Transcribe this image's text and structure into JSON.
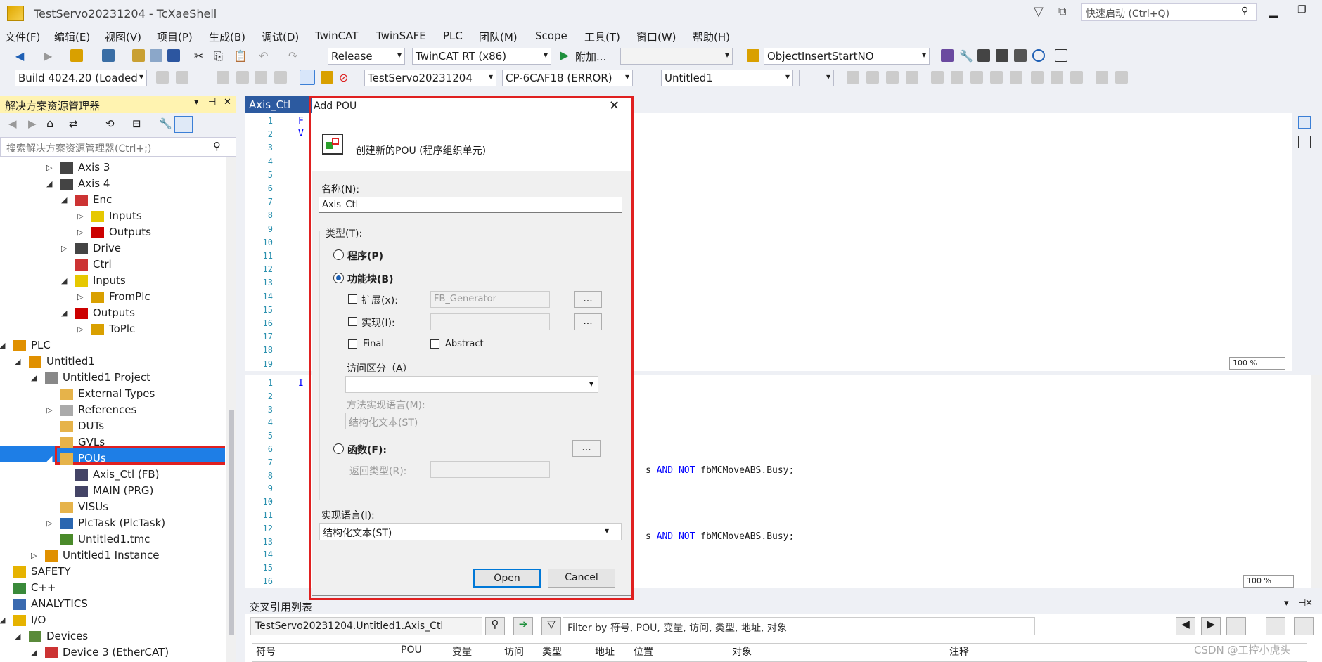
{
  "window": {
    "title": "TestServo20231204 - TcXaeShell",
    "quick_launch": "快速启动 (Ctrl+Q)"
  },
  "menu": [
    "文件(F)",
    "编辑(E)",
    "视图(V)",
    "项目(P)",
    "生成(B)",
    "调试(D)",
    "TwinCAT",
    "TwinSAFE",
    "PLC",
    "团队(M)",
    "Scope",
    "工具(T)",
    "窗口(W)",
    "帮助(H)"
  ],
  "toolbar1": {
    "config": "Release",
    "platform": "TwinCAT RT (x86)",
    "attach": "附加...",
    "object": "ObjectInsertStartNO"
  },
  "toolbar2": {
    "build": "Build 4024.20 (Loaded",
    "solution": "TestServo20231204",
    "target": "CP-6CAF18 (ERROR)",
    "project": "Untitled1"
  },
  "solution_explorer": {
    "title": "解决方案资源管理器",
    "search_placeholder": "搜索解决方案资源管理器(Ctrl+;)",
    "items": [
      {
        "label": "Axis 3"
      },
      {
        "label": "Axis 4"
      },
      {
        "label": "Enc"
      },
      {
        "label": "Inputs"
      },
      {
        "label": "Outputs"
      },
      {
        "label": "Drive"
      },
      {
        "label": "Ctrl"
      },
      {
        "label": "Inputs"
      },
      {
        "label": "FromPlc"
      },
      {
        "label": "Outputs"
      },
      {
        "label": "ToPlc"
      },
      {
        "label": "PLC"
      },
      {
        "label": "Untitled1"
      },
      {
        "label": "Untitled1 Project"
      },
      {
        "label": "External Types"
      },
      {
        "label": "References"
      },
      {
        "label": "DUTs"
      },
      {
        "label": "GVLs"
      },
      {
        "label": "POUs"
      },
      {
        "label": "Axis_Ctl (FB)"
      },
      {
        "label": "MAIN (PRG)"
      },
      {
        "label": "VISUs"
      },
      {
        "label": "PlcTask (PlcTask)"
      },
      {
        "label": "Untitled1.tmc"
      },
      {
        "label": "Untitled1 Instance"
      },
      {
        "label": "SAFETY"
      },
      {
        "label": "C++"
      },
      {
        "label": "ANALYTICS"
      },
      {
        "label": "I/O"
      },
      {
        "label": "Devices"
      },
      {
        "label": "Device 3 (EtherCAT)"
      }
    ]
  },
  "editor": {
    "tab": "Axis_Ctl",
    "top_lines": [
      "1",
      "2",
      "3",
      "4",
      "5",
      "6",
      "7",
      "8",
      "9",
      "10",
      "11",
      "12",
      "13",
      "14",
      "15",
      "16",
      "17",
      "18",
      "19"
    ],
    "bottom_lines": [
      "1",
      "2",
      "3",
      "4",
      "5",
      "6",
      "7",
      "8",
      "9",
      "10",
      "11",
      "12",
      "13",
      "14",
      "15",
      "16"
    ],
    "code_line_a": "s AND NOT fbMCMoveABS.Busy;",
    "code_line_b": "s AND NOT fbMCMoveABS.Busy;",
    "top_first": "F",
    "top_second": "V",
    "bottom_first": "I",
    "zoom_top": "100 %",
    "zoom_bottom": "100 %"
  },
  "dialog": {
    "title": "Add POU",
    "header": "创建新的POU (程序组织单元)",
    "name_label": "名称(N):",
    "name_value": "Axis_Ctl",
    "type_label": "类型(T):",
    "program": "程序(P)",
    "function_block": "功能块(B)",
    "extends": "扩展(x):",
    "extends_value": "FB_Generator",
    "implements": "实现(I):",
    "final": "Final",
    "abstract": "Abstract",
    "access": "访问区分（A）",
    "method_lang": "方法实现语言(M):",
    "method_lang_value": "结构化文本(ST)",
    "function": "函数(F):",
    "return_type": "返回类型(R):",
    "impl_lang": "实现语言(I):",
    "impl_lang_value": "结构化文本(ST)",
    "open": "Open",
    "cancel": "Cancel",
    "ellipsis": "..."
  },
  "xref": {
    "title": "交叉引用列表",
    "path": "TestServo20231204.Untitled1.Axis_Ctl",
    "filter_placeholder": "Filter by 符号, POU, 变量, 访问, 类型, 地址, 对象",
    "columns": [
      "符号",
      "POU",
      "变量",
      "访问",
      "类型",
      "地址",
      "位置",
      "对象",
      "注释"
    ]
  },
  "watermark": "CSDN @工控小虎头"
}
